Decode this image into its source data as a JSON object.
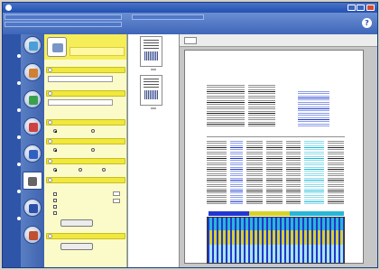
{
  "window": {
    "title": "",
    "accent": "#2250b0",
    "panel_color": "#f6ee58"
  },
  "header": {
    "row1_left": "",
    "row2_left": "",
    "tab_label": "",
    "right_line1": "",
    "right_line2": "",
    "right_line3": ""
  },
  "panel": {
    "header_title": "",
    "sections": [
      {
        "label": "",
        "icon": "info-icon"
      },
      {
        "label": "",
        "icon": "info-icon"
      },
      {
        "label": "",
        "icon": "info-icon"
      },
      {
        "label": "",
        "icon": "info-icon"
      },
      {
        "label": "",
        "icon": "info-icon"
      },
      {
        "label": "",
        "icon": "info-icon"
      },
      {
        "label": "",
        "icon": "info-icon"
      }
    ],
    "field1_value": "",
    "field2_value": "",
    "radio_groups": [
      {
        "options": [
          "",
          ""
        ],
        "selected": 0
      },
      {
        "options": [
          "",
          ""
        ],
        "selected": 0
      },
      {
        "options": [
          "",
          "",
          ""
        ],
        "selected": 0
      }
    ],
    "print_options": {
      "col1_title": "",
      "col2_title": "",
      "checkboxes": [
        "",
        "",
        "",
        ""
      ],
      "label_a": "",
      "label_b": "",
      "value_a": "",
      "value_b": ""
    },
    "print_button": "",
    "run_button": ""
  },
  "thumbnails": [
    {
      "caption": ""
    },
    {
      "caption": ""
    }
  ],
  "document": {
    "title": "",
    "doc_id": "",
    "doc_date": "",
    "right_heading": ""
  }
}
